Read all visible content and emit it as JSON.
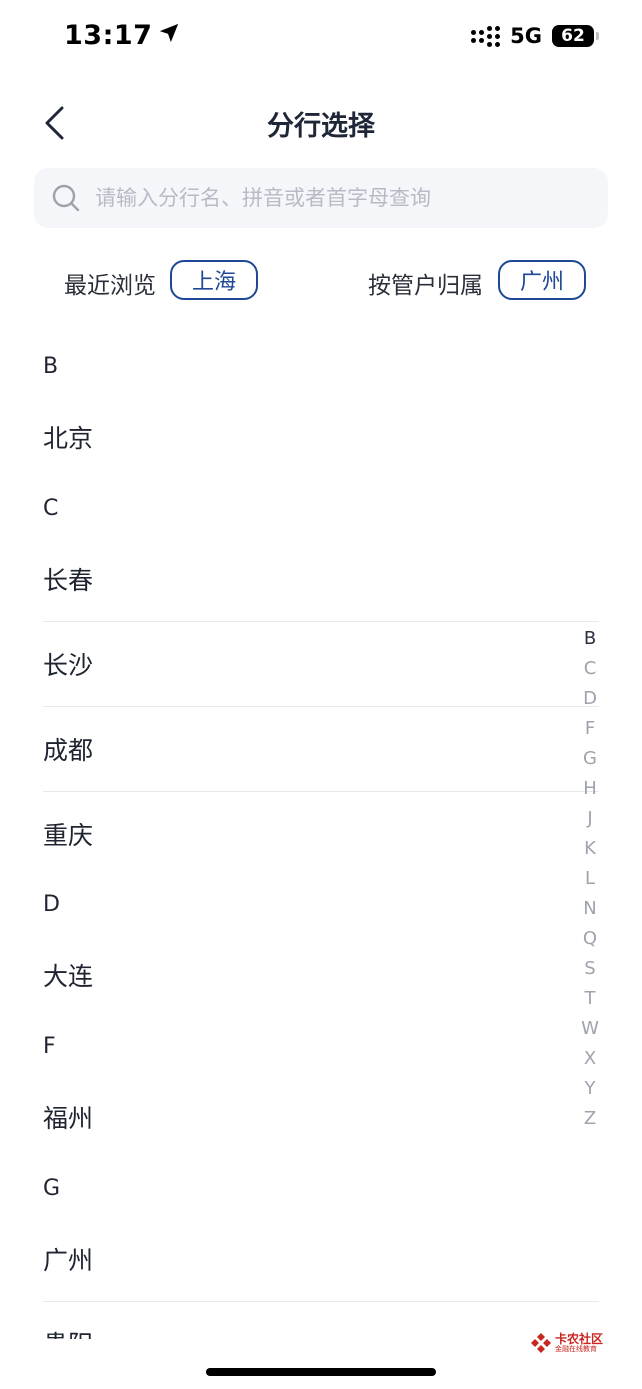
{
  "status_bar": {
    "time": "13:17",
    "network": "5G",
    "battery": "62",
    "icons": [
      "location-arrow-icon",
      "cellular-signal-icon",
      "battery-icon"
    ]
  },
  "nav": {
    "title": "分行选择",
    "back_icon": "chevron-left-icon"
  },
  "search": {
    "placeholder": "请输入分行名、拼音或者首字母查询",
    "value": "",
    "icon": "search-icon"
  },
  "quick": {
    "recent_label": "最近浏览",
    "recent_city": "上海",
    "owner_label": "按管户归属",
    "owner_city": "广州"
  },
  "sections": [
    {
      "letter": "B",
      "cities": [
        "北京"
      ]
    },
    {
      "letter": "C",
      "cities": [
        "长春",
        "长沙",
        "成都",
        "重庆"
      ]
    },
    {
      "letter": "D",
      "cities": [
        "大连"
      ]
    },
    {
      "letter": "F",
      "cities": [
        "福州"
      ]
    },
    {
      "letter": "G",
      "cities": [
        "广州",
        "贵阳"
      ]
    }
  ],
  "alpha_index": [
    "B",
    "C",
    "D",
    "F",
    "G",
    "H",
    "J",
    "K",
    "L",
    "N",
    "Q",
    "S",
    "T",
    "W",
    "X",
    "Y",
    "Z"
  ],
  "alpha_active": "B",
  "watermark": {
    "title": "卡农社区",
    "subtitle": "金融在线教育"
  },
  "colors": {
    "accent": "#1e4796",
    "text": "#1f2430",
    "index_inactive": "#9ea3ad",
    "search_bg": "#f5f6f9",
    "watermark": "#c8261f"
  }
}
